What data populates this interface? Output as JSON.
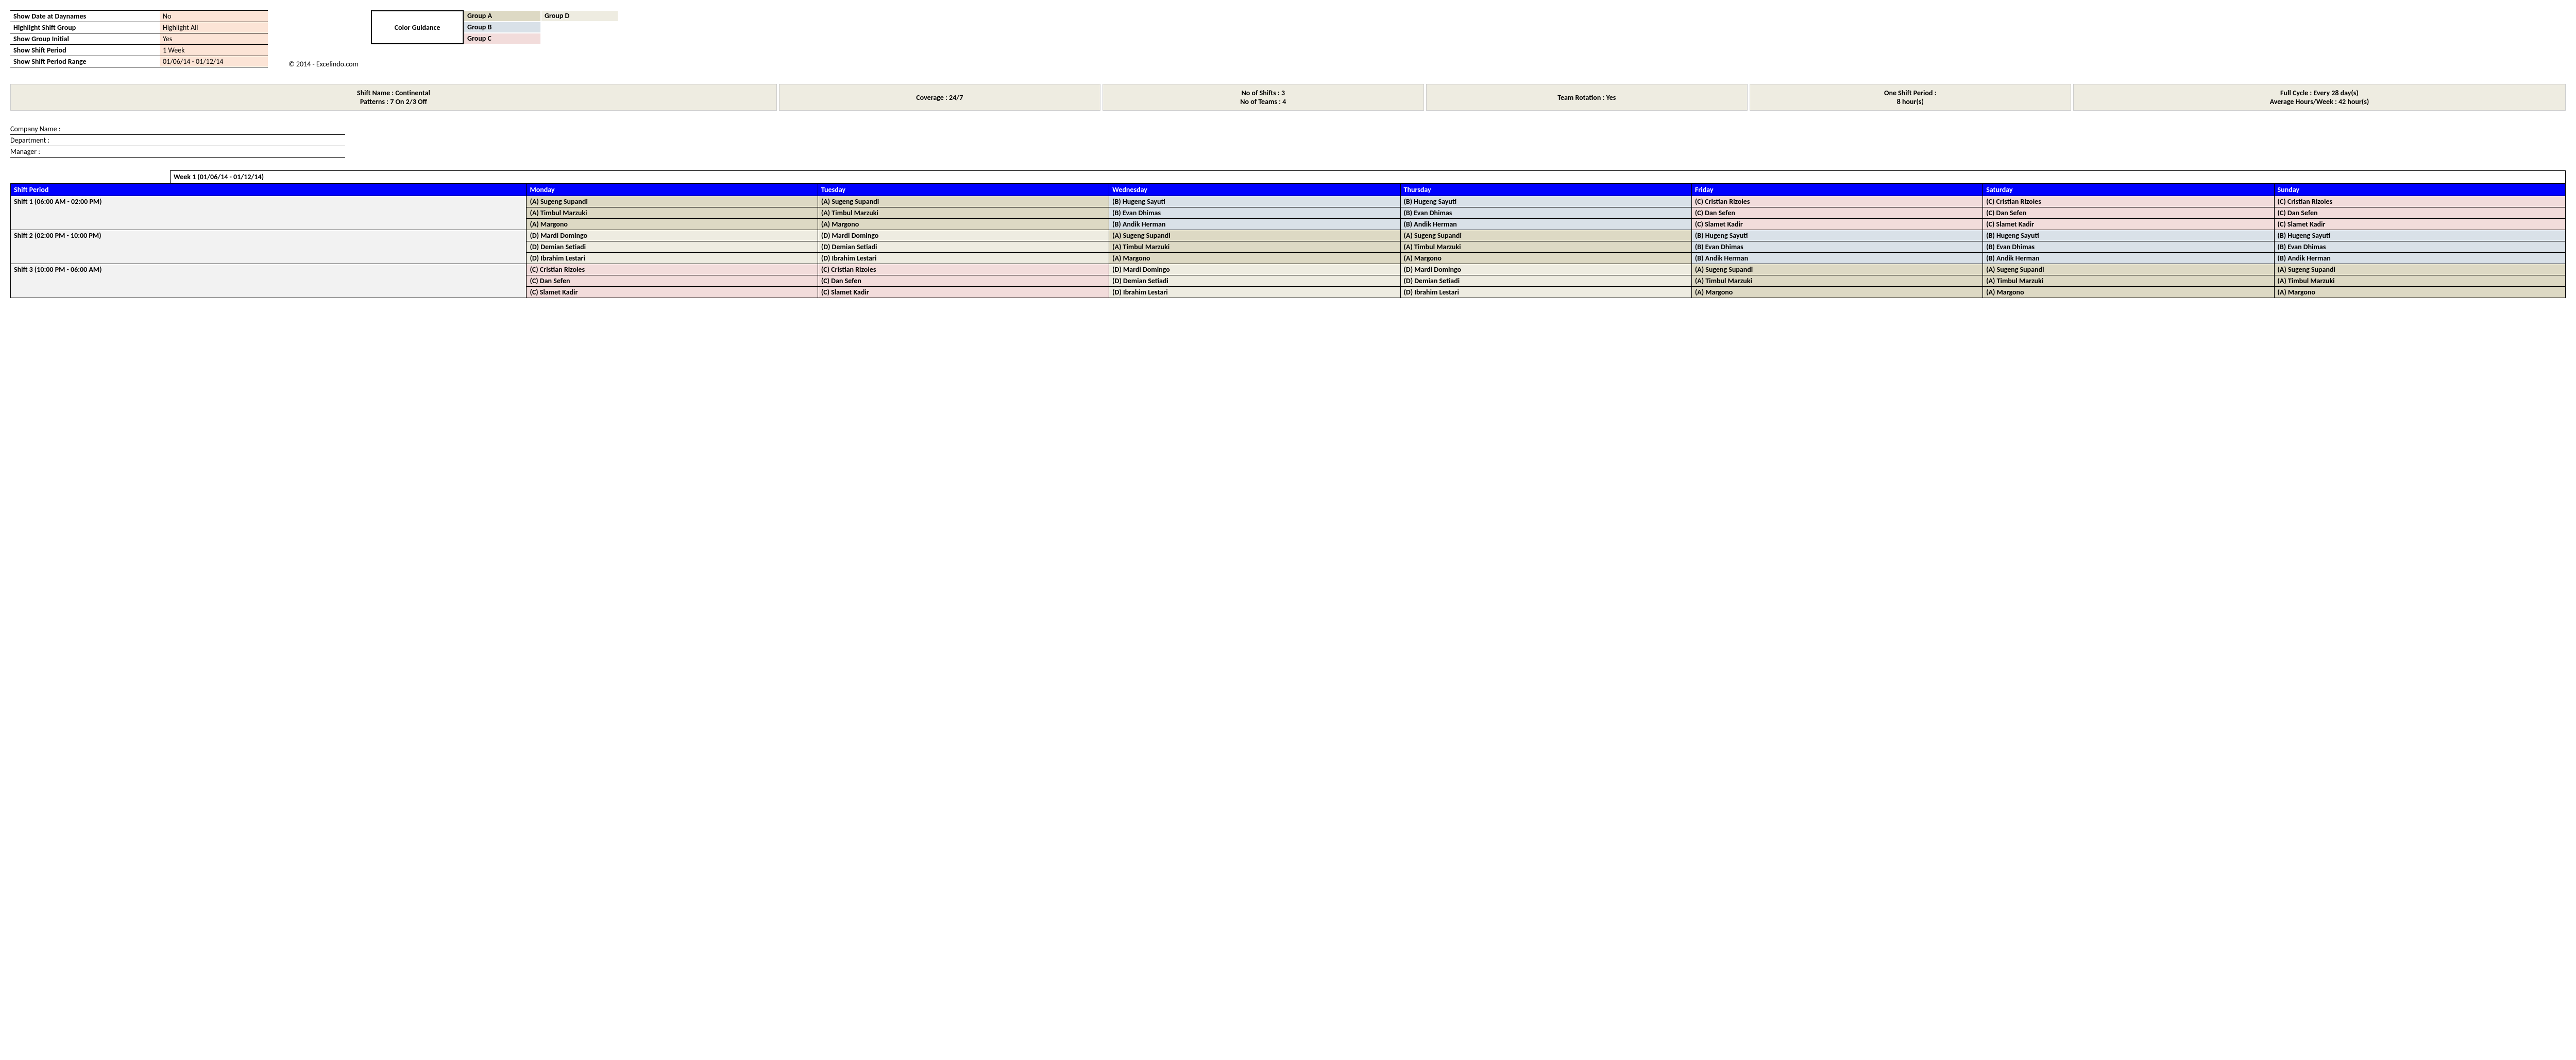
{
  "settings": [
    {
      "label": "Show Date at Daynames",
      "value": "No"
    },
    {
      "label": "Highlight Shift Group",
      "value": "Highlight All"
    },
    {
      "label": "Show Group Initial",
      "value": "Yes"
    },
    {
      "label": "Show Shift Period",
      "value": "1 Week"
    },
    {
      "label": "Show Shift Period Range",
      "value": "01/06/14 - 01/12/14"
    }
  ],
  "color_guidance": {
    "title": "Color Guidance",
    "groups": [
      {
        "name": "Group A",
        "cls": "gA"
      },
      {
        "name": "Group B",
        "cls": "gB"
      },
      {
        "name": "Group C",
        "cls": "gC"
      },
      {
        "name": "Group D",
        "cls": "gD"
      }
    ]
  },
  "copyright": "© 2014 - Excelindo.com",
  "summary": {
    "shift_name": "Shift Name : Continental",
    "patterns": "Patterns : 7 On 2/3 Off",
    "coverage": "Coverage : 24/7",
    "no_shifts": "No of Shifts : 3",
    "no_teams": "No of Teams : 4",
    "team_rotation": "Team Rotation : Yes",
    "one_shift_1": "One Shift Period :",
    "one_shift_2": "8 hour(s)",
    "full_cycle": "Full Cycle : Every 28 day(s)",
    "avg_hours": "Average Hours/Week : 42 hour(s)"
  },
  "company": {
    "name_label": "Company Name :",
    "dept_label": "Department :",
    "mgr_label": "Manager :"
  },
  "week_header": "Week 1 (01/06/14 - 01/12/14)",
  "schedule": {
    "headers": [
      "Shift Period",
      "Monday",
      "Tuesday",
      "Wednesday",
      "Thursday",
      "Friday",
      "Saturday",
      "Sunday"
    ],
    "shifts": [
      {
        "label": "Shift 1 (06:00 AM - 02:00 PM)",
        "rows": [
          [
            {
              "t": "(A) Sugeng Supandi",
              "g": "gA"
            },
            {
              "t": "(A) Sugeng Supandi",
              "g": "gA"
            },
            {
              "t": "(B) Hugeng Sayuti",
              "g": "gB"
            },
            {
              "t": "(B) Hugeng Sayuti",
              "g": "gB"
            },
            {
              "t": "(C) Cristian Rizoles",
              "g": "gC"
            },
            {
              "t": "(C) Cristian Rizoles",
              "g": "gC"
            },
            {
              "t": "(C) Cristian Rizoles",
              "g": "gC"
            }
          ],
          [
            {
              "t": "(A) Timbul Marzuki",
              "g": "gA"
            },
            {
              "t": "(A) Timbul Marzuki",
              "g": "gA"
            },
            {
              "t": "(B) Evan Dhimas",
              "g": "gB"
            },
            {
              "t": "(B) Evan Dhimas",
              "g": "gB"
            },
            {
              "t": "(C) Dan Sefen",
              "g": "gC"
            },
            {
              "t": "(C) Dan Sefen",
              "g": "gC"
            },
            {
              "t": "(C) Dan Sefen",
              "g": "gC"
            }
          ],
          [
            {
              "t": "(A) Margono",
              "g": "gA"
            },
            {
              "t": "(A) Margono",
              "g": "gA"
            },
            {
              "t": "(B) Andik Herman",
              "g": "gB"
            },
            {
              "t": "(B) Andik Herman",
              "g": "gB"
            },
            {
              "t": "(C) Slamet Kadir",
              "g": "gC"
            },
            {
              "t": "(C) Slamet Kadir",
              "g": "gC"
            },
            {
              "t": "(C) Slamet Kadir",
              "g": "gC"
            }
          ]
        ]
      },
      {
        "label": "Shift 2 (02:00 PM - 10:00 PM)",
        "rows": [
          [
            {
              "t": "(D) Mardi Domingo",
              "g": "gD"
            },
            {
              "t": "(D) Mardi Domingo",
              "g": "gD"
            },
            {
              "t": "(A) Sugeng Supandi",
              "g": "gA"
            },
            {
              "t": "(A) Sugeng Supandi",
              "g": "gA"
            },
            {
              "t": "(B) Hugeng Sayuti",
              "g": "gB"
            },
            {
              "t": "(B) Hugeng Sayuti",
              "g": "gB"
            },
            {
              "t": "(B) Hugeng Sayuti",
              "g": "gB"
            }
          ],
          [
            {
              "t": "(D) Demian Setiadi",
              "g": "gD"
            },
            {
              "t": "(D) Demian Setiadi",
              "g": "gD"
            },
            {
              "t": "(A) Timbul Marzuki",
              "g": "gA"
            },
            {
              "t": "(A) Timbul Marzuki",
              "g": "gA"
            },
            {
              "t": "(B) Evan Dhimas",
              "g": "gB"
            },
            {
              "t": "(B) Evan Dhimas",
              "g": "gB"
            },
            {
              "t": "(B) Evan Dhimas",
              "g": "gB"
            }
          ],
          [
            {
              "t": "(D) Ibrahim Lestari",
              "g": "gD"
            },
            {
              "t": "(D) Ibrahim Lestari",
              "g": "gD"
            },
            {
              "t": "(A) Margono",
              "g": "gA"
            },
            {
              "t": "(A) Margono",
              "g": "gA"
            },
            {
              "t": "(B) Andik Herman",
              "g": "gB"
            },
            {
              "t": "(B) Andik Herman",
              "g": "gB"
            },
            {
              "t": "(B) Andik Herman",
              "g": "gB"
            }
          ]
        ]
      },
      {
        "label": "Shift 3 (10:00 PM - 06:00 AM)",
        "rows": [
          [
            {
              "t": "(C) Cristian Rizoles",
              "g": "gC"
            },
            {
              "t": "(C) Cristian Rizoles",
              "g": "gC"
            },
            {
              "t": "(D) Mardi Domingo",
              "g": "gD"
            },
            {
              "t": "(D) Mardi Domingo",
              "g": "gD"
            },
            {
              "t": "(A) Sugeng Supandi",
              "g": "gA"
            },
            {
              "t": "(A) Sugeng Supandi",
              "g": "gA"
            },
            {
              "t": "(A) Sugeng Supandi",
              "g": "gA"
            }
          ],
          [
            {
              "t": "(C) Dan Sefen",
              "g": "gC"
            },
            {
              "t": "(C) Dan Sefen",
              "g": "gC"
            },
            {
              "t": "(D) Demian Setiadi",
              "g": "gD"
            },
            {
              "t": "(D) Demian Setiadi",
              "g": "gD"
            },
            {
              "t": "(A) Timbul Marzuki",
              "g": "gA"
            },
            {
              "t": "(A) Timbul Marzuki",
              "g": "gA"
            },
            {
              "t": "(A) Timbul Marzuki",
              "g": "gA"
            }
          ],
          [
            {
              "t": "(C) Slamet Kadir",
              "g": "gC"
            },
            {
              "t": "(C) Slamet Kadir",
              "g": "gC"
            },
            {
              "t": "(D) Ibrahim Lestari",
              "g": "gD"
            },
            {
              "t": "(D) Ibrahim Lestari",
              "g": "gD"
            },
            {
              "t": "(A) Margono",
              "g": "gA"
            },
            {
              "t": "(A) Margono",
              "g": "gA"
            },
            {
              "t": "(A) Margono",
              "g": "gA"
            }
          ]
        ]
      }
    ]
  }
}
